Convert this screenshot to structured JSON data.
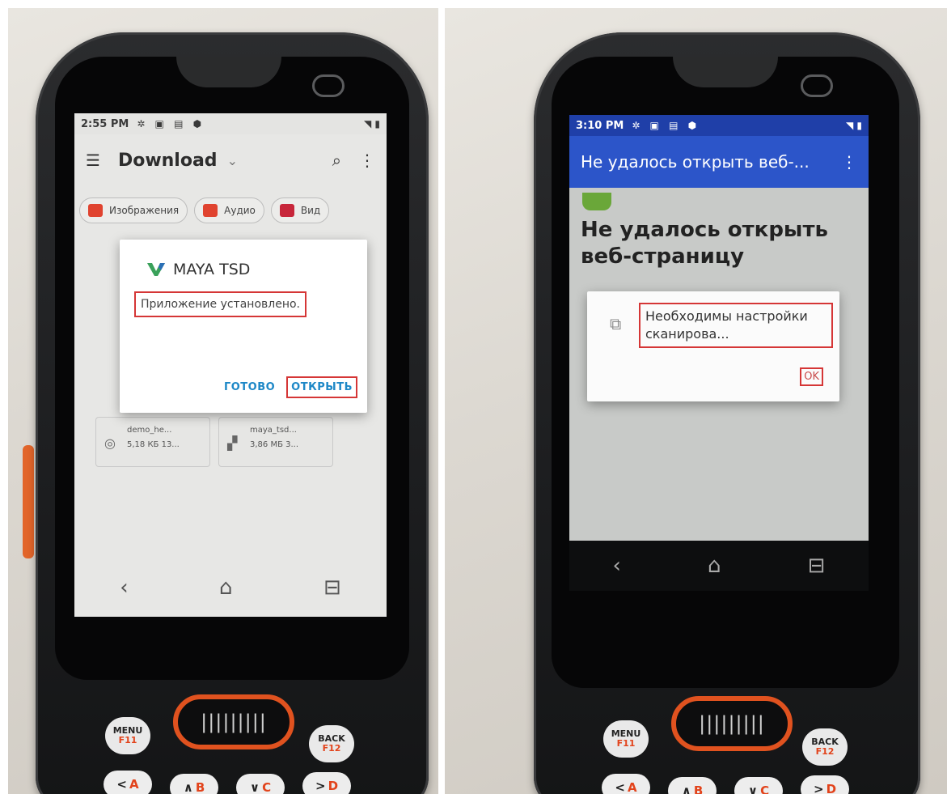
{
  "left": {
    "status": {
      "time": "2:55 PM",
      "icons": "✲ ▣ ▤ ⬢",
      "right_icons": "◥ ▮"
    },
    "toolbar": {
      "menu_icon": "menu-icon",
      "title": "Download",
      "chevron": "⌄",
      "search": "⌕",
      "more": "⋮"
    },
    "chips": [
      {
        "label": "Изображения",
        "color": "#e0432f"
      },
      {
        "label": "Аудио",
        "color": "#e0432f"
      },
      {
        "label": "Вид",
        "color": "#c7263a"
      }
    ],
    "dialog": {
      "app_name": "MAYA TSD",
      "message": "Приложение установлено.",
      "done_button": "ГОТОВО",
      "open_button": "ОТКРЫТЬ"
    },
    "files": [
      {
        "name": "demo_he...",
        "meta": "5,18 КБ 13..."
      },
      {
        "name": "maya_tsd...",
        "meta": "3,86 МБ 3..."
      }
    ],
    "nav": {
      "back": "‹",
      "home": "⌂",
      "recent": "⊟"
    }
  },
  "right": {
    "status": {
      "time": "3:10 PM",
      "icons": "✲ ▣ ▤ ⬢",
      "right_icons": "◥ ▮"
    },
    "appbar": {
      "title": "Не удалось открыть веб-...",
      "more": "⋮"
    },
    "heading": "Не удалось открыть веб-страницу",
    "dialog": {
      "message": "Необходимы настройки сканирова...",
      "ok_button": "OK"
    },
    "nav": {
      "back": "‹",
      "home": "⌂",
      "recent": "⊟"
    }
  },
  "keypad": {
    "menu": "MENU",
    "menu_sub": "F11",
    "back": "BACK",
    "back_sub": "F12",
    "scan_grip": "|||||||||",
    "keys": [
      {
        "arrow": "<",
        "letter": "A"
      },
      {
        "arrow": "∧",
        "letter": "B"
      },
      {
        "arrow": "∨",
        "letter": "C"
      },
      {
        "arrow": ">",
        "letter": "D"
      }
    ]
  },
  "colors": {
    "highlight_box": "#d53636",
    "accent_blue": "#1e88c7",
    "appbar_blue": "#2c55c9",
    "key_orange": "#e0521f"
  }
}
